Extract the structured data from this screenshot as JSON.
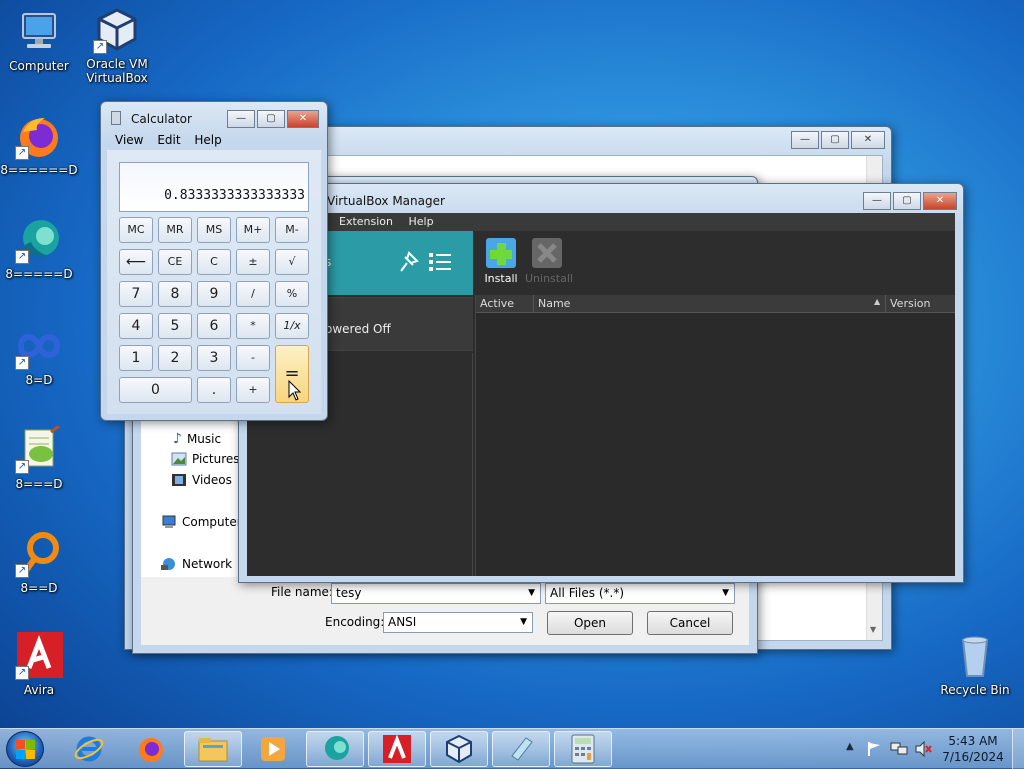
{
  "desktop": {
    "icons": [
      {
        "label": "Computer"
      },
      {
        "label": "Oracle VM VirtualBox"
      },
      {
        "label": "8======D"
      },
      {
        "label": "8=====D"
      },
      {
        "label": "8=D"
      },
      {
        "label": "8===D"
      },
      {
        "label": "8==D"
      },
      {
        "label": "Avira"
      },
      {
        "label": "Recycle Bin"
      }
    ]
  },
  "save_dialog": {
    "nav": [
      {
        "label": "Music",
        "icon": "music-icon"
      },
      {
        "label": "Pictures",
        "icon": "pictures-icon"
      },
      {
        "label": "Videos",
        "icon": "videos-icon"
      },
      {
        "label": "Computer",
        "icon": "computer-icon"
      },
      {
        "label": "Network",
        "icon": "network-icon"
      }
    ],
    "filename_label": "File name:",
    "filename_value": "tesy",
    "filetype_value": "All Files  (*.*)",
    "encoding_label": "Encoding:",
    "encoding_value": "ANSI",
    "open_label": "Open",
    "cancel_label": "Cancel"
  },
  "virtualbox": {
    "title": "VirtualBox Manager",
    "menu": [
      "Extension",
      "Help"
    ],
    "tools_suffix": "s",
    "vm_state": "owered Off",
    "install_label": "Install",
    "uninstall_label": "Uninstall",
    "columns": {
      "active": "Active",
      "name": "Name",
      "version": "Version"
    }
  },
  "calculator": {
    "title": "Calculator",
    "menu": [
      "View",
      "Edit",
      "Help"
    ],
    "display": "0.8333333333333333",
    "buttons": {
      "mc": "MC",
      "mr": "MR",
      "ms": "MS",
      "mplus": "M+",
      "mminus": "M-",
      "back": "⟵",
      "ce": "CE",
      "c": "C",
      "plusminus": "±",
      "sqrt": "√",
      "n7": "7",
      "n8": "8",
      "n9": "9",
      "div": "/",
      "pct": "%",
      "n4": "4",
      "n5": "5",
      "n6": "6",
      "mul": "*",
      "recip": "1/x",
      "n1": "1",
      "n2": "2",
      "n3": "3",
      "sub": "-",
      "eq": "=",
      "n0": "0",
      "dot": ".",
      "add": "+"
    }
  },
  "taskbar": {
    "time": "5:43 AM",
    "date": "7/16/2024",
    "items": [
      "start-orb",
      "internet-explorer",
      "firefox",
      "file-explorer",
      "media-player",
      "app-teal",
      "avira",
      "virtualbox",
      "notepad",
      "calculator"
    ]
  }
}
